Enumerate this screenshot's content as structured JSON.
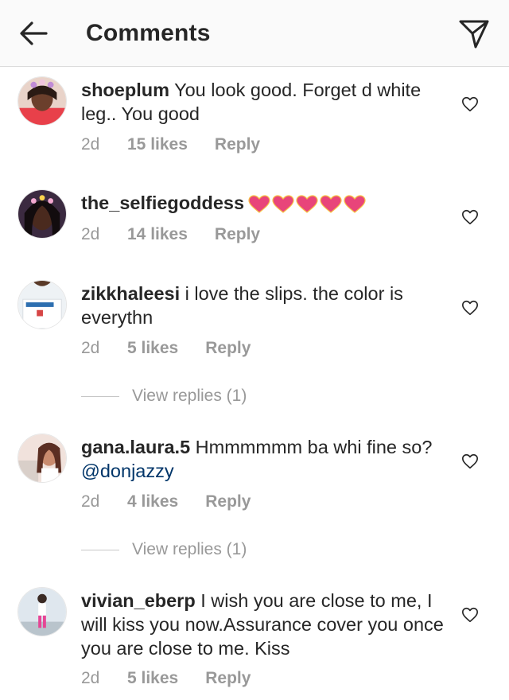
{
  "header": {
    "title": "Comments",
    "back_icon": "arrow-left-icon",
    "direct_icon": "paper-plane-icon"
  },
  "comments": [
    {
      "username": "shoeplum",
      "text": " You look good. Forget d white leg.. You good",
      "time": "2d",
      "likes": "15 likes",
      "reply": "Reply"
    },
    {
      "username": "the_selfiegoddess",
      "text": "",
      "emoji": "pink-heart-icons",
      "emoji_count": 5,
      "time": "2d",
      "likes": "14 likes",
      "reply": "Reply"
    },
    {
      "username": "zikkhaleesi",
      "text": " i love the slips. the color is everythn",
      "time": "2d",
      "likes": "5 likes",
      "reply": "Reply",
      "view_replies": "View replies (1)"
    },
    {
      "username": "gana.laura.5",
      "text": " Hmmmmmm ba whi fine so? ",
      "mention": "@donjazzy",
      "time": "2d",
      "likes": "4 likes",
      "reply": "Reply",
      "view_replies": "View replies (1)"
    },
    {
      "username": "vivian_eberp",
      "text": " I wish you are close to me, I will kiss you now.Assurance cover you once you are close to me. Kiss",
      "time": "2d",
      "likes": "5 likes",
      "reply": "Reply"
    }
  ],
  "colors": {
    "text": "#262626",
    "meta": "#999999",
    "mention": "#003569",
    "header_bg": "#fafafa",
    "heart_emoji": "#e8457a"
  }
}
